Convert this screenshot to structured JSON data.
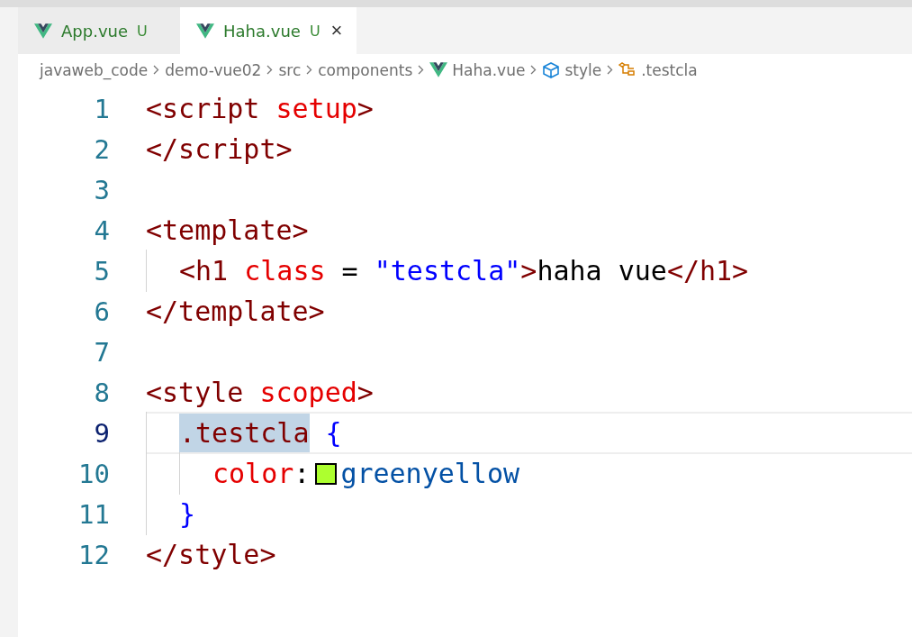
{
  "tabs": [
    {
      "label": "App.vue",
      "badge": "U",
      "selected": false
    },
    {
      "label": "Haha.vue",
      "badge": "U",
      "selected": true,
      "close": "×"
    }
  ],
  "breadcrumb": [
    {
      "label": "javaweb_code",
      "kind": "folder"
    },
    {
      "label": "demo-vue02",
      "kind": "folder"
    },
    {
      "label": "src",
      "kind": "folder"
    },
    {
      "label": "components",
      "kind": "folder"
    },
    {
      "label": "Haha.vue",
      "kind": "vue"
    },
    {
      "label": "style",
      "kind": "module"
    },
    {
      "label": ".testcla",
      "kind": "selector"
    }
  ],
  "lines": [
    {
      "number": "1",
      "current": false,
      "tokens": [
        {
          "text": "<script",
          "kind": "tag"
        },
        {
          "text": " setup",
          "kind": "attr"
        },
        {
          "text": ">",
          "kind": "tag"
        }
      ]
    },
    {
      "number": "2",
      "current": false,
      "tokens": [
        {
          "text": "</script>",
          "kind": "tag"
        }
      ]
    },
    {
      "number": "3",
      "current": false
    },
    {
      "number": "4",
      "current": false,
      "tokens": [
        {
          "text": "<template>",
          "kind": "tag"
        }
      ],
      "children": [
        {
          "number": "5",
          "current": false,
          "tokens": [
            {
              "text": "<h1",
              "kind": "tag"
            },
            {
              "text": " class",
              "kind": "attr"
            },
            {
              "text": " = ",
              "kind": "plain"
            },
            {
              "text": "\"testcla\"",
              "kind": "string"
            },
            {
              "text": ">",
              "kind": "tag"
            },
            {
              "text": "haha vue",
              "kind": "plain"
            },
            {
              "text": "</h1>",
              "kind": "tag"
            }
          ]
        }
      ]
    },
    {
      "number": "6",
      "current": false,
      "tokens": [
        {
          "text": "</template>",
          "kind": "tag"
        }
      ]
    },
    {
      "number": "7",
      "current": false
    },
    {
      "number": "8",
      "current": false,
      "tokens": [
        {
          "text": "<style",
          "kind": "tag"
        },
        {
          "text": " scoped",
          "kind": "attr"
        },
        {
          "text": ">",
          "kind": "tag"
        }
      ],
      "children": [
        {
          "number": "9",
          "current": true,
          "tokens": [
            {
              "text": ".testcla",
              "kind": "selector",
              "highlight": true
            },
            {
              "text": " {",
              "kind": "brace"
            }
          ],
          "children": [
            {
              "number": "10",
              "current": false,
              "tokens": [
                {
                  "text": "color",
                  "kind": "prop"
                },
                {
                  "text": ":",
                  "kind": "plain"
                },
                {
                  "kind": "swatch",
                  "color": "#adff2f"
                },
                {
                  "text": "greenyellow",
                  "kind": "value"
                }
              ]
            }
          ]
        },
        {
          "number": "11",
          "current": false,
          "tokens": [
            {
              "text": "}",
              "kind": "brace"
            }
          ]
        }
      ]
    },
    {
      "number": "12",
      "current": false,
      "tokens": [
        {
          "text": "</style>",
          "kind": "tag"
        }
      ]
    }
  ]
}
